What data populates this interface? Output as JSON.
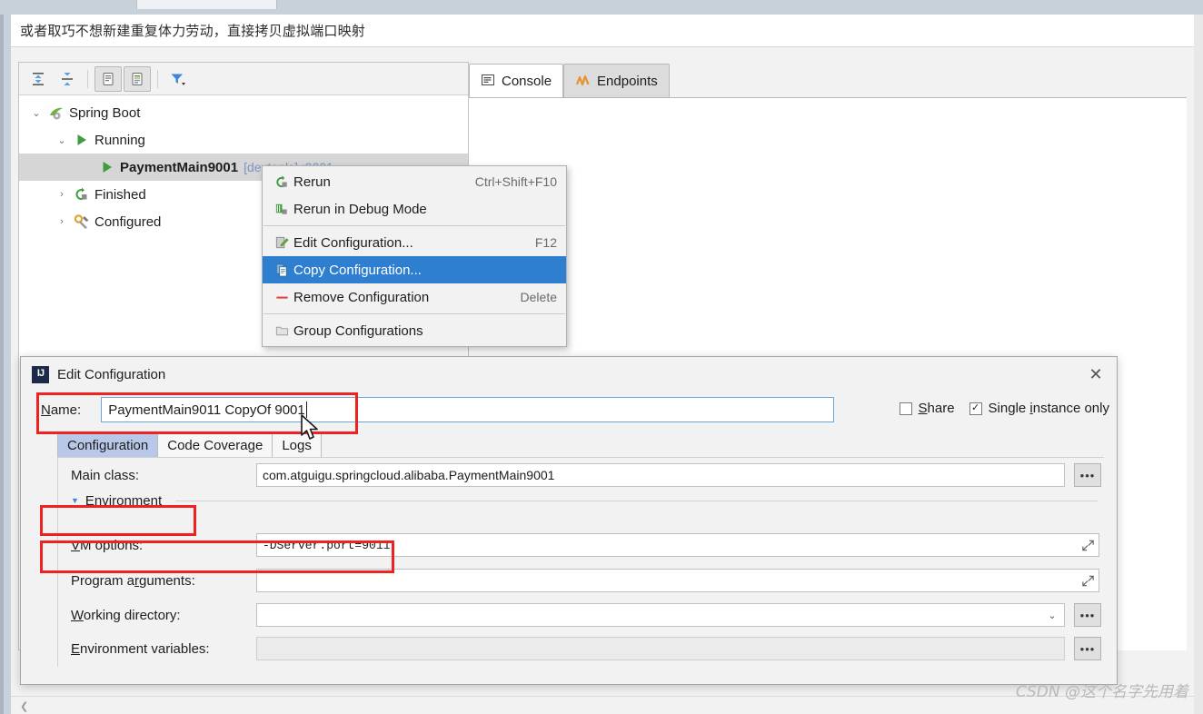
{
  "note": {
    "text": "或者取巧不想新建重复体力劳动，直接拷贝虚拟端口映射"
  },
  "run_toolbar": {
    "buttons": [
      {
        "name": "expand-all-icon",
        "tooltip": "Expand All"
      },
      {
        "name": "collapse-all-icon",
        "tooltip": "Collapse All"
      },
      {
        "name": "show-console-icon",
        "tooltip": "Show Console"
      },
      {
        "name": "show-output-icon",
        "tooltip": "Show Output"
      },
      {
        "name": "filter-icon",
        "tooltip": "Filter"
      }
    ]
  },
  "tree": {
    "nodes": [
      {
        "label": "Spring Boot",
        "icon": "spring-boot-icon",
        "chevron": "⌄",
        "depth": 0,
        "bold": false,
        "selected": false,
        "sub": ""
      },
      {
        "label": "Running",
        "icon": "run-green-icon",
        "chevron": "⌄",
        "depth": 1,
        "bold": false,
        "selected": false,
        "sub": ""
      },
      {
        "label": "PaymentMain9001",
        "icon": "run-green-icon",
        "chevron": "",
        "depth": 2,
        "bold": true,
        "selected": true,
        "sub": "[devtools] :9001"
      },
      {
        "label": "Finished",
        "icon": "rerun-icon",
        "chevron": "›",
        "depth": 1,
        "bold": false,
        "selected": false,
        "sub": ""
      },
      {
        "label": "Configured",
        "icon": "wrench-icon",
        "chevron": "›",
        "depth": 1,
        "bold": false,
        "selected": false,
        "sub": ""
      }
    ]
  },
  "console_tabs": [
    {
      "label": "Console",
      "icon": "console-icon",
      "active": true
    },
    {
      "label": "Endpoints",
      "icon": "endpoints-icon",
      "active": false
    }
  ],
  "context_menu": {
    "items": [
      {
        "label": "Rerun",
        "shortcut": "Ctrl+Shift+F10",
        "icon": "rerun-icon",
        "selected": false,
        "separator_after": false
      },
      {
        "label": "Rerun in Debug Mode",
        "shortcut": "",
        "icon": "debug-icon",
        "selected": false,
        "separator_after": true
      },
      {
        "label": "Edit Configuration...",
        "shortcut": "F12",
        "icon": "edit-config-icon",
        "selected": false,
        "separator_after": false
      },
      {
        "label": "Copy Configuration...",
        "shortcut": "",
        "icon": "copy-icon",
        "selected": true,
        "separator_after": false
      },
      {
        "label": "Remove Configuration",
        "shortcut": "Delete",
        "icon": "minus-icon",
        "selected": false,
        "separator_after": true
      },
      {
        "label": "Group Configurations",
        "shortcut": "",
        "icon": "folder-icon",
        "selected": false,
        "separator_after": false
      }
    ]
  },
  "dialog": {
    "title": "Edit Configuration",
    "close_label": "✕",
    "name_label": "Name:",
    "name_value": "PaymentMain9011 CopyOf 9001",
    "share": {
      "label": "Share",
      "checked": false,
      "mark": ""
    },
    "single_instance": {
      "label": "Single instance only",
      "checked": true,
      "mark": "✓"
    },
    "tabs": [
      {
        "label": "Configuration",
        "active": true
      },
      {
        "label": "Code Coverage",
        "active": false
      },
      {
        "label": "Logs",
        "active": false
      }
    ],
    "fields": {
      "main_class": {
        "label": "Main class:",
        "value": "com.atguigu.springcloud.alibaba.PaymentMain9001",
        "browse": "•••"
      },
      "environment_section": {
        "label": "Environment",
        "triangle": "▼"
      },
      "vm_options": {
        "label": "VM options:",
        "value": "-DServer.port=9011",
        "expand": "⤡"
      },
      "program_arguments": {
        "label": "Program arguments:",
        "value": "",
        "expand": "⤡"
      },
      "working_directory": {
        "label": "Working directory:",
        "value": "",
        "arrow": "⌄",
        "browse": "•••"
      },
      "environment_variables": {
        "label": "Environment variables:",
        "value": "",
        "browse": "•••"
      }
    }
  },
  "watermark": {
    "text": "CSDN @这个名字先用着"
  },
  "colors": {
    "accent_selection": "#2f7fd1",
    "annotation_red": "#ef2222",
    "tab_active": "#b9c8e8",
    "green_run": "#3f9c3f",
    "field_focus_border": "#6aa7d8"
  }
}
